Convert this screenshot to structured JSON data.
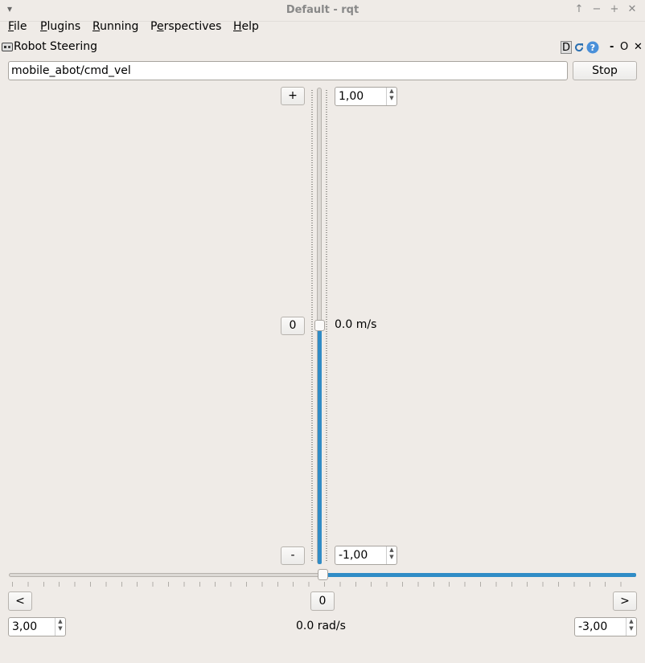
{
  "window": {
    "title": "Default - rqt",
    "menu_glyph": "▾",
    "controls": [
      "↑",
      "−",
      "+",
      "✕"
    ]
  },
  "menubar": {
    "items": [
      {
        "pre": "",
        "underline": "F",
        "post": "ile"
      },
      {
        "pre": "",
        "underline": "P",
        "post": "lugins"
      },
      {
        "pre": "",
        "underline": "R",
        "post": "unning"
      },
      {
        "pre": "P",
        "underline": "e",
        "post": "rspectives"
      },
      {
        "pre": "",
        "underline": "H",
        "post": "elp"
      }
    ]
  },
  "plugin": {
    "title": "Robot Steering",
    "icon": "gamepad-icon",
    "header_buttons": {
      "d": "D",
      "reload_icon": "reload-icon",
      "help_icon": "help-icon",
      "minimize": "-",
      "float": "O",
      "close": "✕"
    }
  },
  "topic": {
    "value": "mobile_abot/cmd_vel",
    "stop_label": "Stop"
  },
  "linear": {
    "plus_label": "+",
    "zero_label": "0",
    "minus_label": "-",
    "max_value": "1,00",
    "min_value": "-1,00",
    "readout": "0.0 m/s",
    "slider_fraction": 0.5
  },
  "angular": {
    "left_label": "<",
    "zero_label": "0",
    "right_label": ">",
    "max_value": "3,00",
    "min_value": "-3,00",
    "readout": "0.0 rad/s",
    "slider_fraction": 0.5
  },
  "colors": {
    "accent": "#308cc6",
    "background": "#efebe7"
  }
}
